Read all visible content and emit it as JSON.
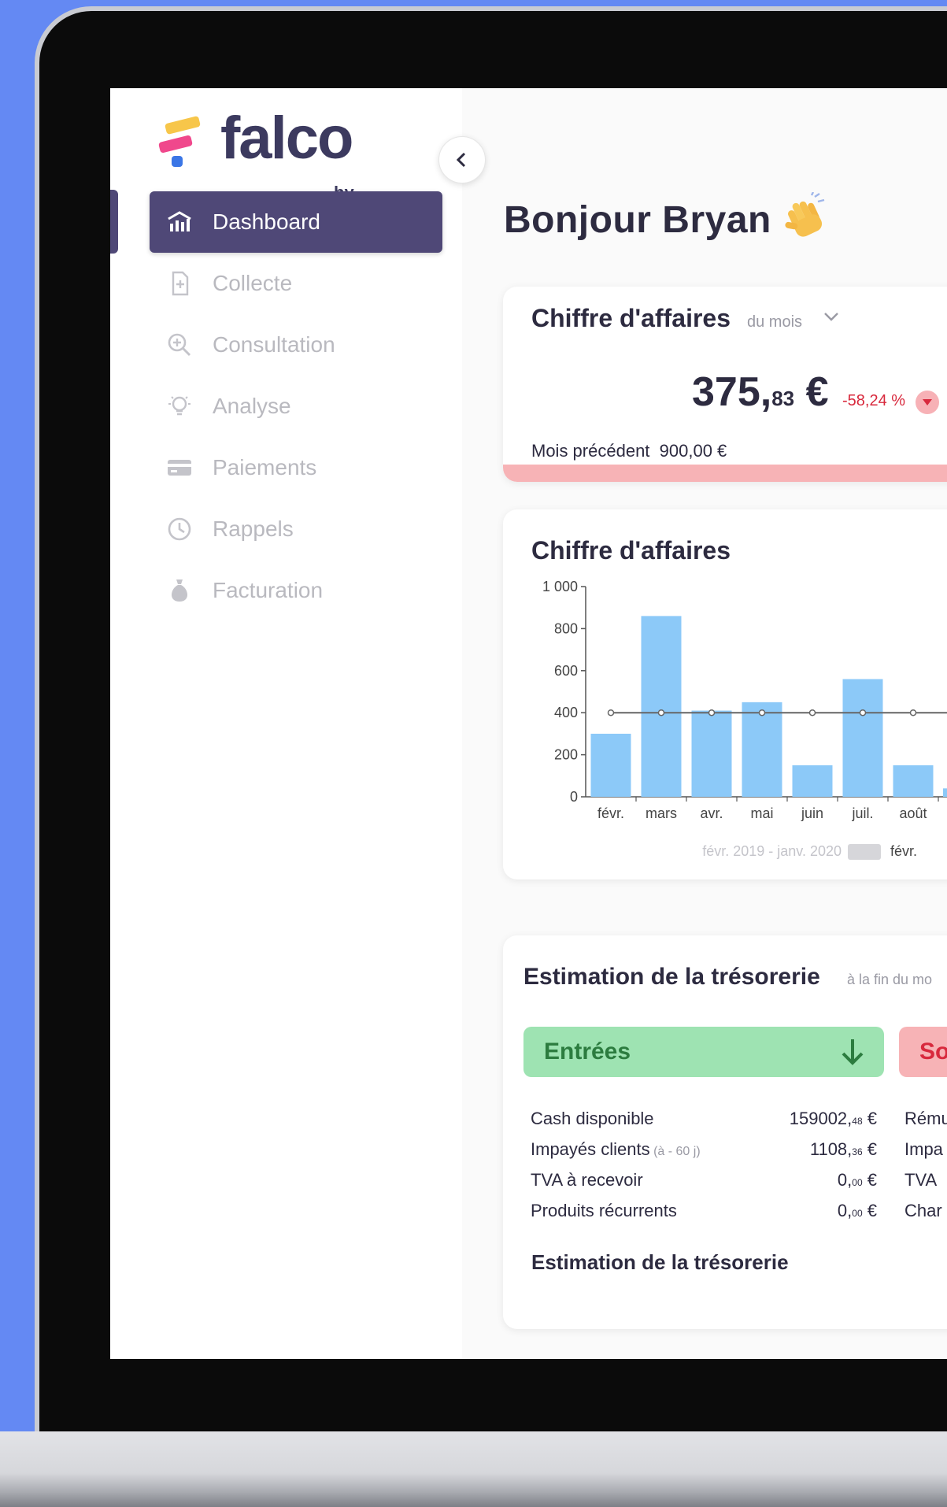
{
  "brand": {
    "name": "falco",
    "tagline": "by horus"
  },
  "sidebar": {
    "items": [
      {
        "label": "Dashboard",
        "icon": "chart-building-icon",
        "active": true
      },
      {
        "label": "Collecte",
        "icon": "document-plus-icon",
        "active": false
      },
      {
        "label": "Consultation",
        "icon": "zoom-plus-icon",
        "active": false
      },
      {
        "label": "Analyse",
        "icon": "lightbulb-icon",
        "active": false
      },
      {
        "label": "Paiements",
        "icon": "credit-card-icon",
        "active": false
      },
      {
        "label": "Rappels",
        "icon": "clock-icon",
        "active": false
      },
      {
        "label": "Facturation",
        "icon": "money-bag-icon",
        "active": false
      }
    ]
  },
  "main": {
    "greeting": "Bonjour Bryan"
  },
  "revenue_card": {
    "title": "Chiffre d'affaires",
    "period": "du mois",
    "amount_int": "375,",
    "amount_cents": "83",
    "currency": " €",
    "variation": "-58,24 %",
    "previous_label": "Mois précédent",
    "previous_value": "900,00 €"
  },
  "chart_card": {
    "title": "Chiffre d'affaires",
    "legend_previous": "févr. 2019 - janv. 2020",
    "legend_current": "févr."
  },
  "treasury_card": {
    "title": "Estimation de la trésorerie",
    "subtitle": "à la fin du mo",
    "entrees_label": "Entrées",
    "sorties_label": "So",
    "entrees_rows": [
      {
        "label": "Cash disponible",
        "note": "",
        "int": "159002,",
        "cents": "48",
        "currency": " €"
      },
      {
        "label": "Impayés clients",
        "note": " (à - 60 j)",
        "int": "1108,",
        "cents": "36",
        "currency": " €"
      },
      {
        "label": "TVA à recevoir",
        "note": "",
        "int": "0,",
        "cents": "00",
        "currency": " €"
      },
      {
        "label": "Produits récurrents",
        "note": "",
        "int": "0,",
        "cents": "00",
        "currency": " €"
      }
    ],
    "sorties_rows": [
      "Rému",
      "Impa",
      "TVA",
      "Char"
    ],
    "footer": "Estimation de la trésorerie"
  },
  "colors": {
    "brand_purple": "#4f4877",
    "green": "#9ee3b2",
    "red": "#f7b3b6",
    "bar_blue": "#8cc9f8"
  },
  "chart_data": {
    "type": "bar",
    "categories": [
      "févr.",
      "mars",
      "avr.",
      "mai",
      "juin",
      "juil.",
      "août"
    ],
    "series": [
      {
        "name": "févr.",
        "values": [
          300,
          860,
          410,
          450,
          150,
          560,
          150
        ]
      }
    ],
    "reference_line": 400,
    "ylim": [
      0,
      1000
    ],
    "yticks": [
      "0",
      "200",
      "400",
      "600",
      "800",
      "1 000"
    ]
  }
}
